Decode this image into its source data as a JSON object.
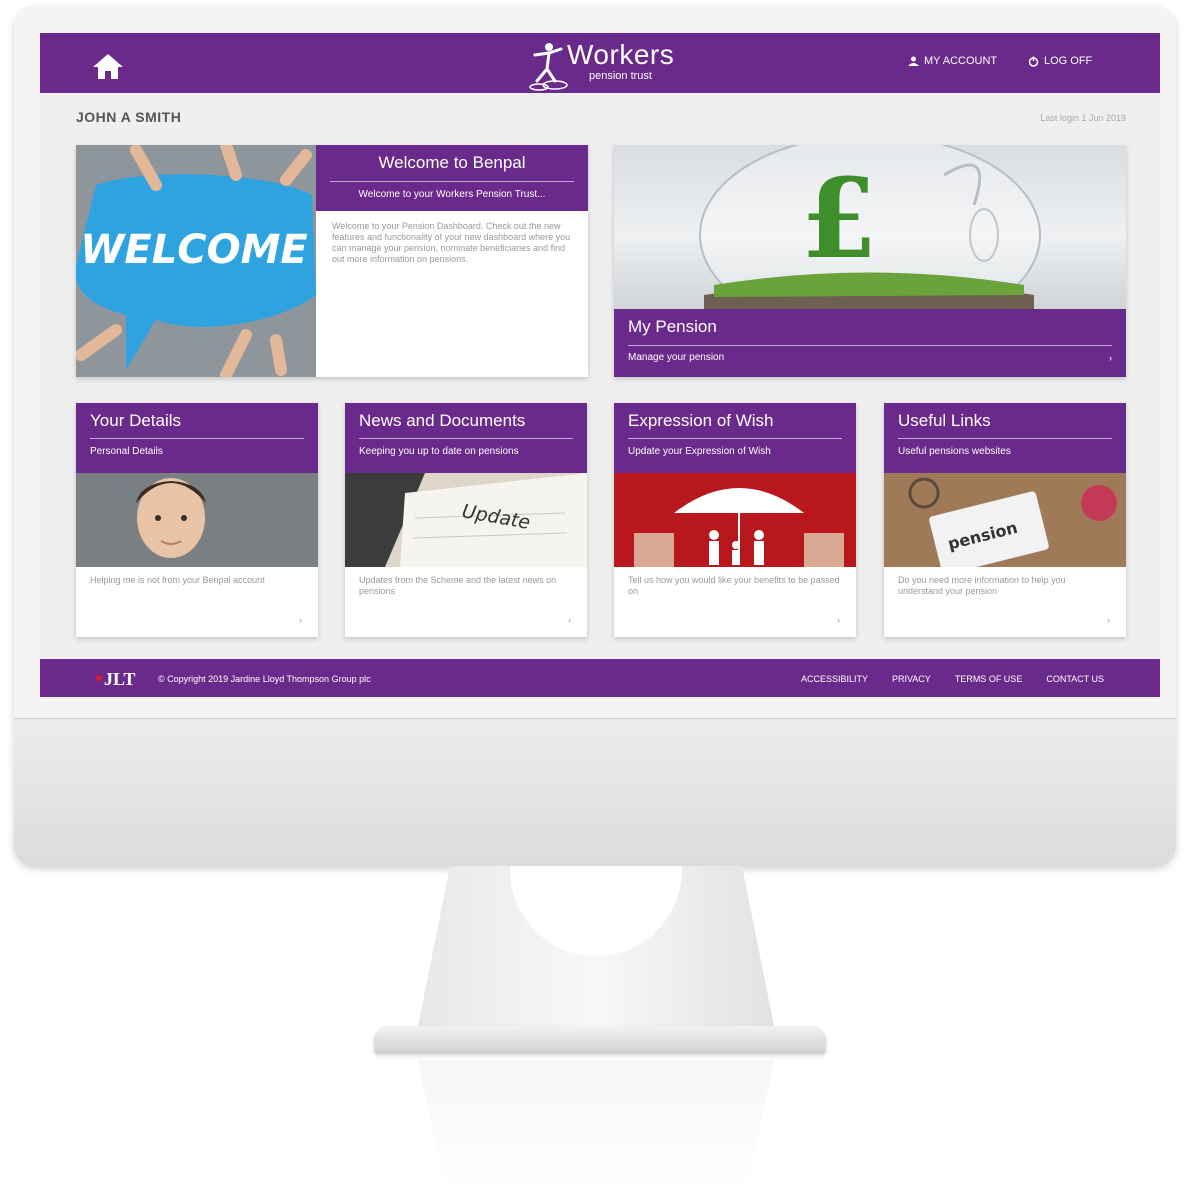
{
  "header": {
    "logo_word": "Workers",
    "logo_sub": "pension trust",
    "my_account": "MY ACCOUNT",
    "log_off": "LOG OFF"
  },
  "user": {
    "name": "JOHN A SMITH",
    "last_login": "Last login 1 Jun 2019"
  },
  "welcome": {
    "image_text": "WELCOME",
    "title": "Welcome to Benpal",
    "subtitle": "Welcome to your Workers Pension Trust...",
    "body": "Welcome to your Pension Dashboard. Check out the new features and functionality of your new dashboard where you can manage your pension, nominate beneficiaries and find out more information on pensions."
  },
  "my_pension": {
    "title": "My Pension",
    "subtitle": "Manage your pension",
    "arrow": "›"
  },
  "cards": [
    {
      "title": "Your Details",
      "subtitle": "Personal Details",
      "desc": "Helping me is not from your Benpal account",
      "arrow": "›"
    },
    {
      "title": "News and Documents",
      "subtitle": "Keeping you up to date on pensions",
      "desc": "Updates from the Scheme and the latest news on pensions",
      "arrow": "›",
      "image_text": "Update"
    },
    {
      "title": "Expression of Wish",
      "subtitle": "Update your Expression of Wish",
      "desc": "Tell us how you would like your benefits to be passed on",
      "arrow": "›"
    },
    {
      "title": "Useful Links",
      "subtitle": "Useful pensions websites",
      "desc": "Do you need more information to help you understand your pension",
      "arrow": "›",
      "image_text": "pension"
    }
  ],
  "footer": {
    "logo": "JLT",
    "copyright": "© Copyright 2019 Jardine Lloyd Thompson Group plc",
    "links": [
      "ACCESSIBILITY",
      "PRIVACY",
      "TERMS OF USE",
      "CONTACT US"
    ]
  },
  "colors": {
    "brand_purple": "#6a2a8c",
    "welcome_blue": "#2fa3df"
  }
}
